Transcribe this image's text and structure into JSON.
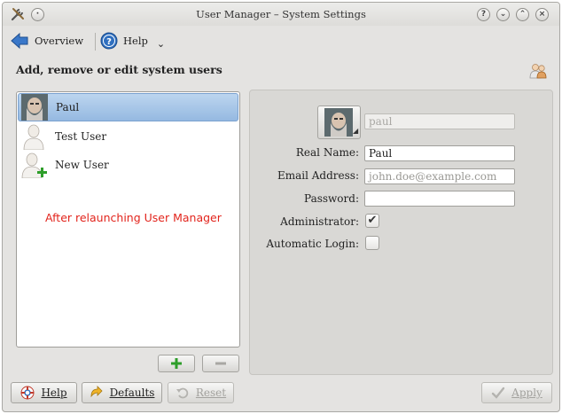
{
  "window": {
    "title": "User Manager – System Settings",
    "controls": [
      "help-icon",
      "minimize-icon",
      "maximize-icon",
      "close-icon"
    ]
  },
  "toolbar": {
    "overview_label": "Overview",
    "help_label": "Help"
  },
  "heading": "Add, remove or edit system users",
  "users": [
    {
      "name": "Paul",
      "selected": true,
      "icon": "photo-avatar-icon"
    },
    {
      "name": "Test User",
      "selected": false,
      "icon": "generic-user-icon"
    },
    {
      "name": "New User",
      "selected": false,
      "icon": "new-user-icon"
    }
  ],
  "annotation": "After relaunching User Manager",
  "list_buttons": {
    "add_icon": "plus-icon",
    "remove_icon": "minus-icon"
  },
  "form": {
    "username_value": "paul",
    "real_name_label": "Real Name:",
    "real_name_value": "Paul",
    "email_label": "Email Address:",
    "email_placeholder": "john.doe@example.com",
    "password_label": "Password:",
    "password_value": "",
    "admin_label": "Administrator:",
    "admin_checked": true,
    "autologin_label": "Automatic Login:",
    "autologin_checked": false
  },
  "footer": {
    "help_label": "Help",
    "defaults_label": "Defaults",
    "reset_label": "Reset",
    "apply_label": "Apply"
  },
  "colors": {
    "selection": "#95b9e1",
    "annotation": "#e2241c",
    "add_green": "#2e9e2a"
  }
}
